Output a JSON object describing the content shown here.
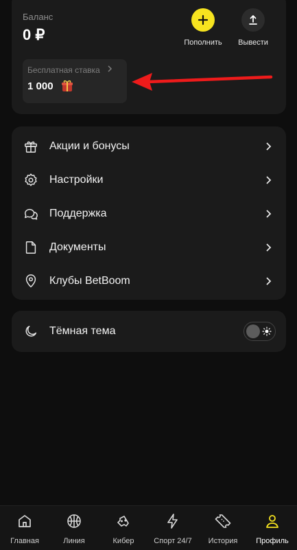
{
  "balance": {
    "label": "Баланс",
    "value": "0 ₽",
    "deposit_label": "Пополнить",
    "withdraw_label": "Вывести",
    "accent_color": "#f6e31f"
  },
  "freebet": {
    "title": "Бесплатная ставка",
    "amount": "1 000",
    "icon": "gift-box-icon"
  },
  "menu": {
    "items": [
      {
        "label": "Акции и бонусы",
        "icon": "gift-icon"
      },
      {
        "label": "Настройки",
        "icon": "gear-icon"
      },
      {
        "label": "Поддержка",
        "icon": "chat-icon"
      },
      {
        "label": "Документы",
        "icon": "document-icon"
      },
      {
        "label": "Клубы BetBoom",
        "icon": "map-pin-icon"
      }
    ]
  },
  "theme": {
    "label": "Тёмная тема",
    "icon": "moon-icon",
    "toggle_state": "off"
  },
  "nav": {
    "tabs": [
      {
        "label": "Главная",
        "icon": "home-icon"
      },
      {
        "label": "Линия",
        "icon": "ball-icon"
      },
      {
        "label": "Кибер",
        "icon": "gamepad-icon"
      },
      {
        "label": "Спорт 24/7",
        "icon": "lightning-icon"
      },
      {
        "label": "История",
        "icon": "ticket-icon"
      },
      {
        "label": "Профиль",
        "icon": "user-icon"
      }
    ],
    "active": "Профиль",
    "active_color": "#f6e31f"
  },
  "annotation": {
    "arrow_color": "#ee1b1b"
  }
}
